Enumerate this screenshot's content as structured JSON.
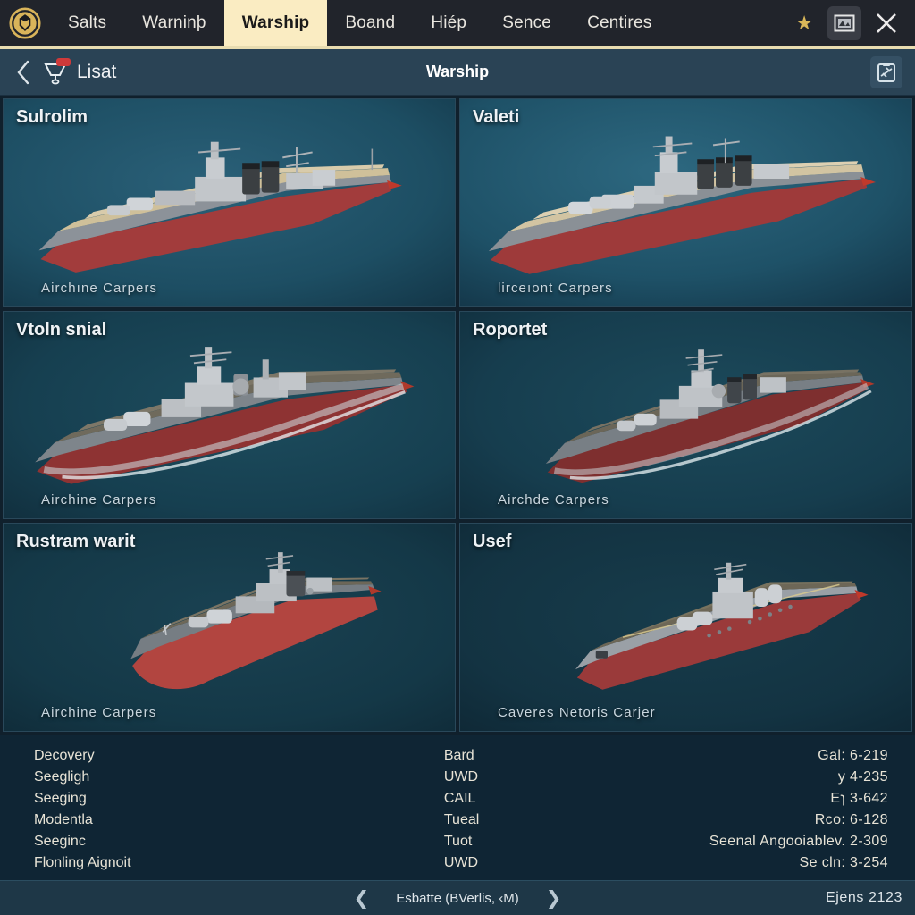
{
  "topnav": {
    "logo_icon": "shield-crest-icon",
    "tabs": [
      {
        "label": "Salts",
        "active": false
      },
      {
        "label": "Warninþ",
        "active": false
      },
      {
        "label": "Warship",
        "active": true
      },
      {
        "label": "Boand",
        "active": false
      },
      {
        "label": "Hiép",
        "active": false
      },
      {
        "label": "Sence",
        "active": false
      },
      {
        "label": "Centires",
        "active": false
      }
    ],
    "star_icon": "star-icon",
    "window_icon": "window-restore-icon",
    "close_icon": "close-icon",
    "accent_color": "#faecc2"
  },
  "subheader": {
    "back_icon": "chevron-left-icon",
    "cart_icon": "cart-icon",
    "cart_label": "Lisat",
    "title": "Warship",
    "right_icon": "clipboard-plane-icon",
    "background_color": "#2a4355"
  },
  "cards": [
    {
      "title": "Sulrolim",
      "subtitle": "Airchıne  Carpers"
    },
    {
      "title": "Valeti",
      "subtitle": "lirceıont  Carpers"
    },
    {
      "title": "Vtoln snial",
      "subtitle": "Airchine  Carpers"
    },
    {
      "title": "Roportet",
      "subtitle": "Airchde  Carpers"
    },
    {
      "title": "Rustram warit",
      "subtitle": "Airchine  Carpers"
    },
    {
      "title": "Usef",
      "subtitle": "Caveres  Netoris  Carjer"
    }
  ],
  "stats": {
    "left": [
      {
        "label": "Decovery"
      },
      {
        "label": "Seegligh"
      },
      {
        "label": "Seeging"
      },
      {
        "label": "Modentla"
      },
      {
        "label": "Seeginc"
      },
      {
        "label": "Flonling Aignoit"
      }
    ],
    "right": [
      {
        "label": "Bard",
        "value": "Gal:  6-219"
      },
      {
        "label": "UWD",
        "value": "y  4-235"
      },
      {
        "label": "CAIL",
        "value": "Eɿ  3-642"
      },
      {
        "label": "Tueal",
        "value": "Rco:  6-128"
      },
      {
        "label": "Tuot",
        "value": "Seenal Angooiablev.  2-309"
      },
      {
        "label": "UWD",
        "value": "Se cln:  3-254"
      }
    ]
  },
  "footer": {
    "prev_icon": "chevron-left-icon",
    "next_icon": "chevron-right-icon",
    "pager_label": "Esbatte (BVerlis, ‹M)",
    "right_label": "Ejens 2123"
  }
}
